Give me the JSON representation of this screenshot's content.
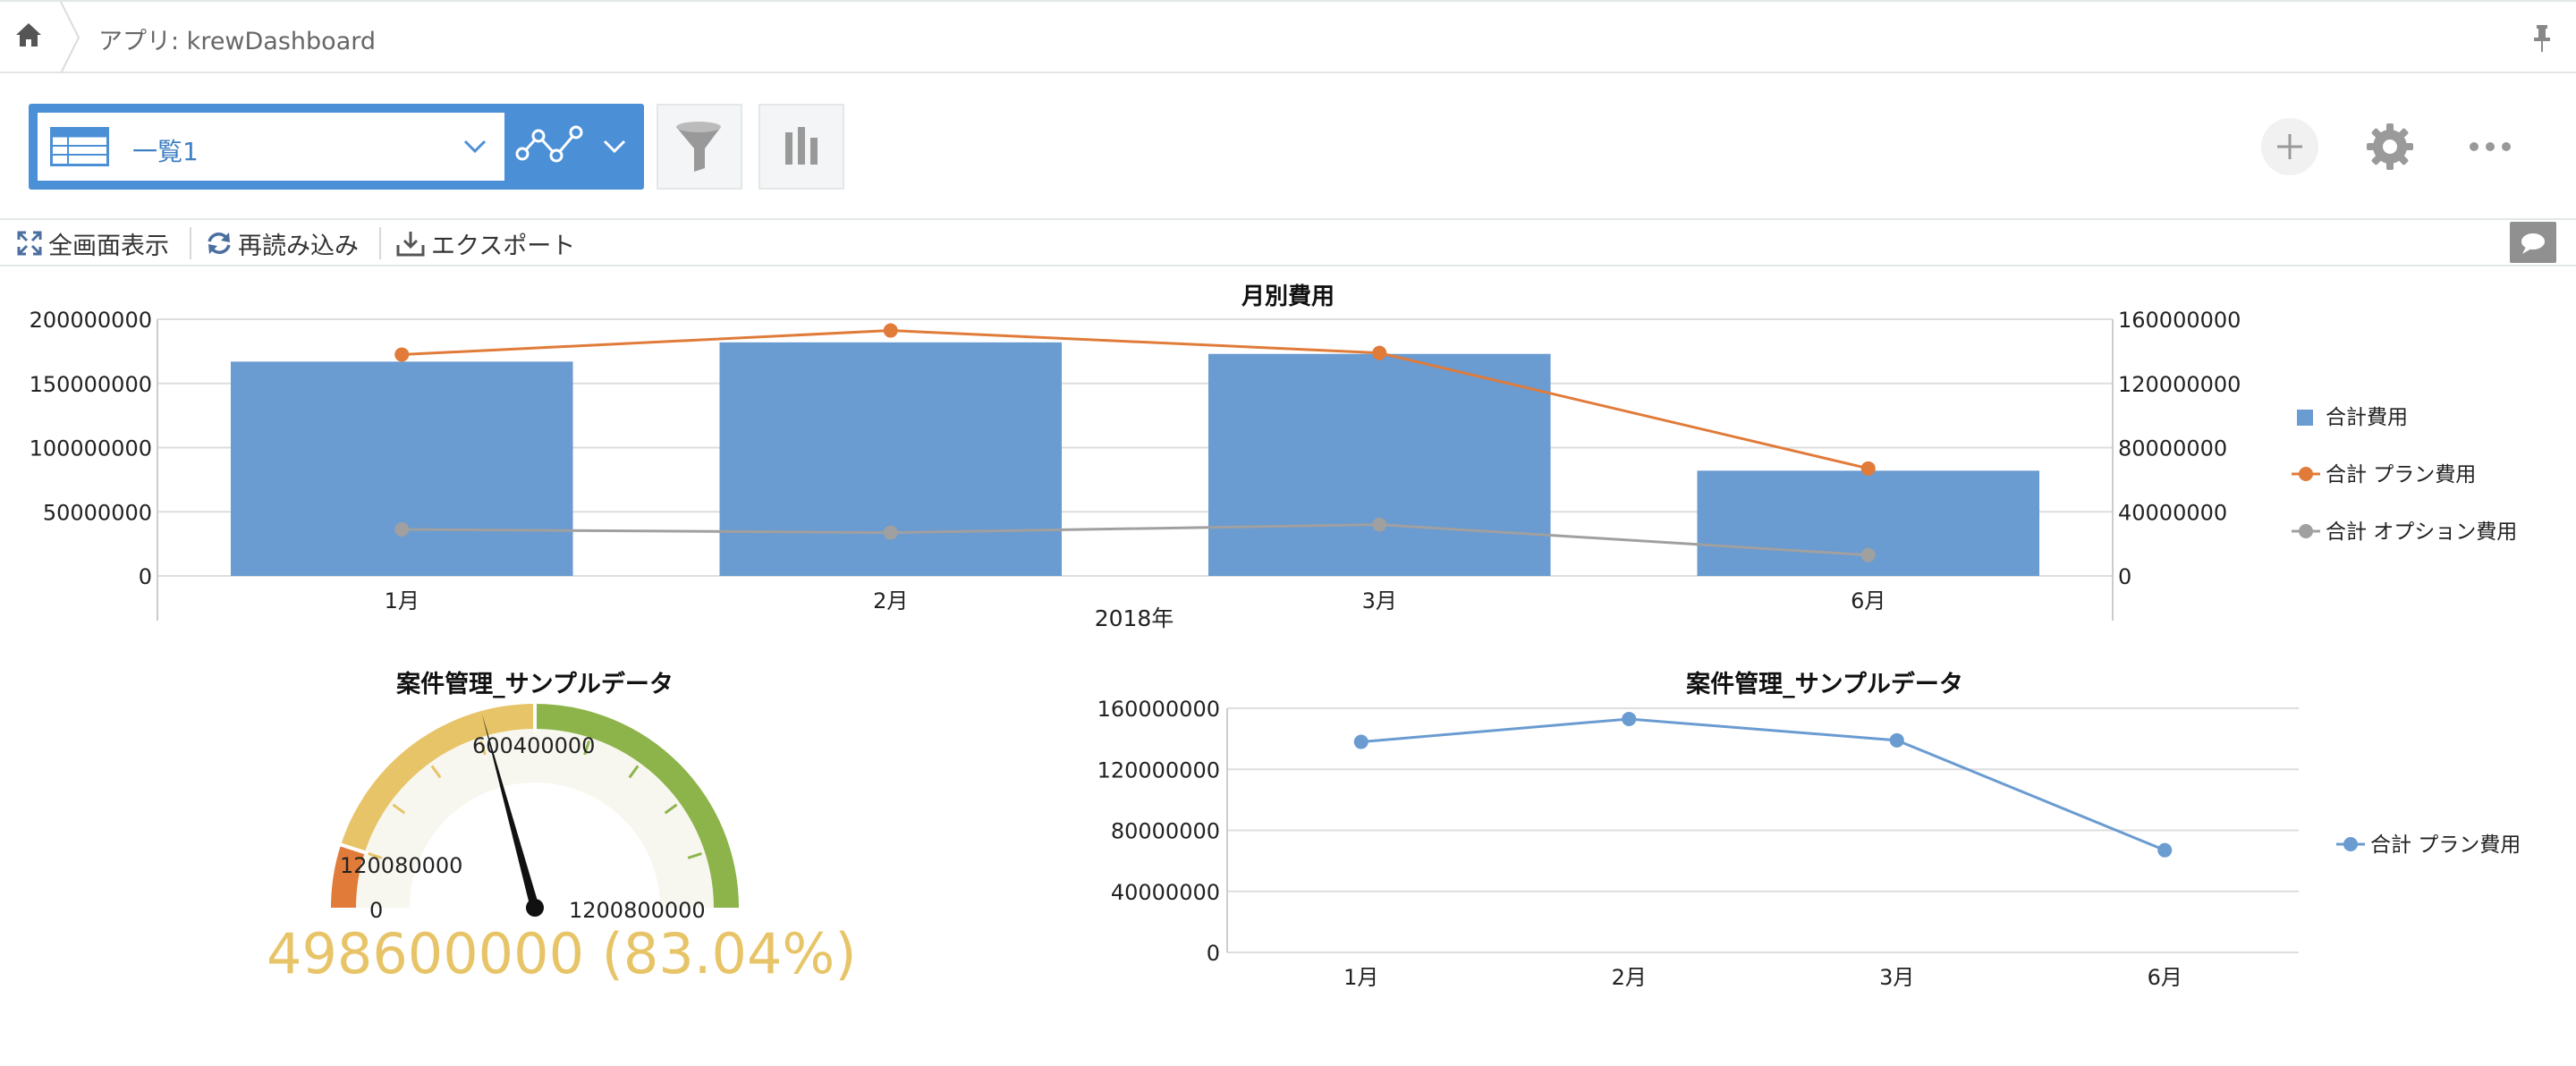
{
  "header": {
    "app_title": "アプリ: krewDashboard"
  },
  "toolbar": {
    "view_name": "一覧1"
  },
  "actions": {
    "fullscreen": "全画面表示",
    "reload": "再読み込み",
    "export": "エクスポート"
  },
  "colors": {
    "accent": "#4b90d6",
    "bar": "#6a9bd1",
    "plan": "#e07b39",
    "option": "#a0a0a0",
    "gauge_red": "#e07b39",
    "gauge_yellow": "#e8c468",
    "gauge_green": "#8db44a"
  },
  "icons": [
    "home-icon",
    "pin-icon",
    "table-icon",
    "chevron-down-icon",
    "line-chart-icon",
    "filter-icon",
    "bar-chart-icon",
    "plus-icon",
    "gear-icon",
    "more-icon",
    "fullscreen-icon",
    "reload-icon",
    "download-icon",
    "comment-icon"
  ],
  "chart_data": [
    {
      "type": "bar",
      "title": "月別費用",
      "xlabel": "2018年",
      "categories": [
        "1月",
        "2月",
        "3月",
        "6月"
      ],
      "ylim_left": [
        0,
        200000000
      ],
      "yticks_left": [
        "0",
        "50000000",
        "100000000",
        "150000000",
        "200000000"
      ],
      "ylim_right": [
        0,
        160000000
      ],
      "yticks_right": [
        "0",
        "40000000",
        "80000000",
        "120000000",
        "160000000"
      ],
      "series": [
        {
          "name": "合計費用",
          "kind": "bar",
          "axis": "left",
          "values": [
            167000000,
            182000000,
            173000000,
            82000000
          ]
        },
        {
          "name": "合計 プラン費用",
          "kind": "line",
          "axis": "right",
          "values": [
            138000000,
            153000000,
            139000000,
            67000000
          ]
        },
        {
          "name": "合計 オプション費用",
          "kind": "line",
          "axis": "right",
          "values": [
            29000000,
            27000000,
            32000000,
            13000000
          ]
        }
      ],
      "legend": "right",
      "grid": true
    },
    {
      "type": "gauge",
      "title": "案件管理_サンプルデータ",
      "min_label": "0",
      "mid_low_label": "120080000",
      "mid_label": "600400000",
      "max_label": "1200800000",
      "min": 0,
      "max": 1200800000,
      "value": 498600000,
      "value_label": "498600000 (83.04%)"
    },
    {
      "type": "line",
      "title": "案件管理_サンプルデータ",
      "categories": [
        "1月",
        "2月",
        "3月",
        "6月"
      ],
      "ylim": [
        0,
        160000000
      ],
      "yticks": [
        "0",
        "40000000",
        "80000000",
        "120000000",
        "160000000"
      ],
      "series": [
        {
          "name": "合計 プラン費用",
          "values": [
            138000000,
            153000000,
            139000000,
            67000000
          ]
        }
      ],
      "legend": "right",
      "grid": true
    }
  ]
}
